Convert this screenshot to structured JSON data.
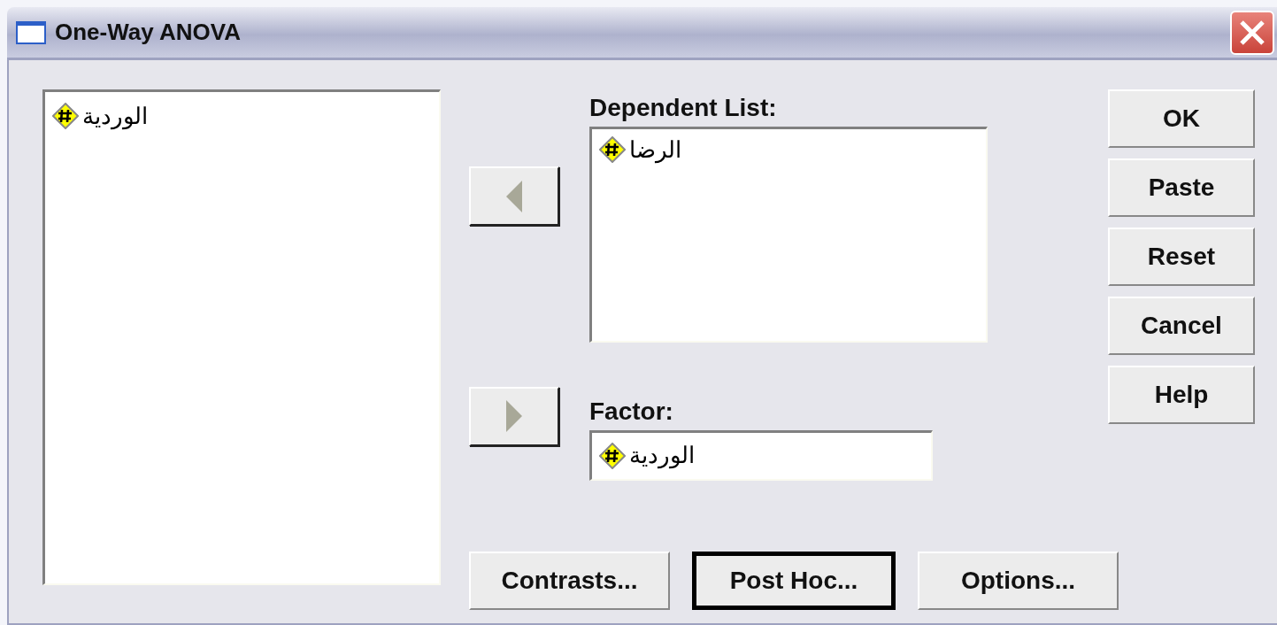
{
  "window": {
    "title": "One-Way ANOVA"
  },
  "variables": [
    {
      "name": "الوردية"
    }
  ],
  "move_buttons": [
    {
      "kind": "left"
    },
    {
      "kind": "right"
    }
  ],
  "dependent_list": {
    "label": "Dependent List:",
    "items": [
      {
        "name": "الرضا"
      }
    ]
  },
  "factor": {
    "label": "Factor:",
    "value": "الوردية"
  },
  "buttons": [
    {
      "label": "OK"
    },
    {
      "label": "Paste"
    },
    {
      "label": "Reset"
    },
    {
      "label": "Cancel"
    },
    {
      "label": "Help"
    }
  ],
  "bottom_buttons": [
    {
      "label": "Contrasts...",
      "default": false
    },
    {
      "label": "Post Hoc...",
      "default": true
    },
    {
      "label": "Options...",
      "default": false
    }
  ]
}
